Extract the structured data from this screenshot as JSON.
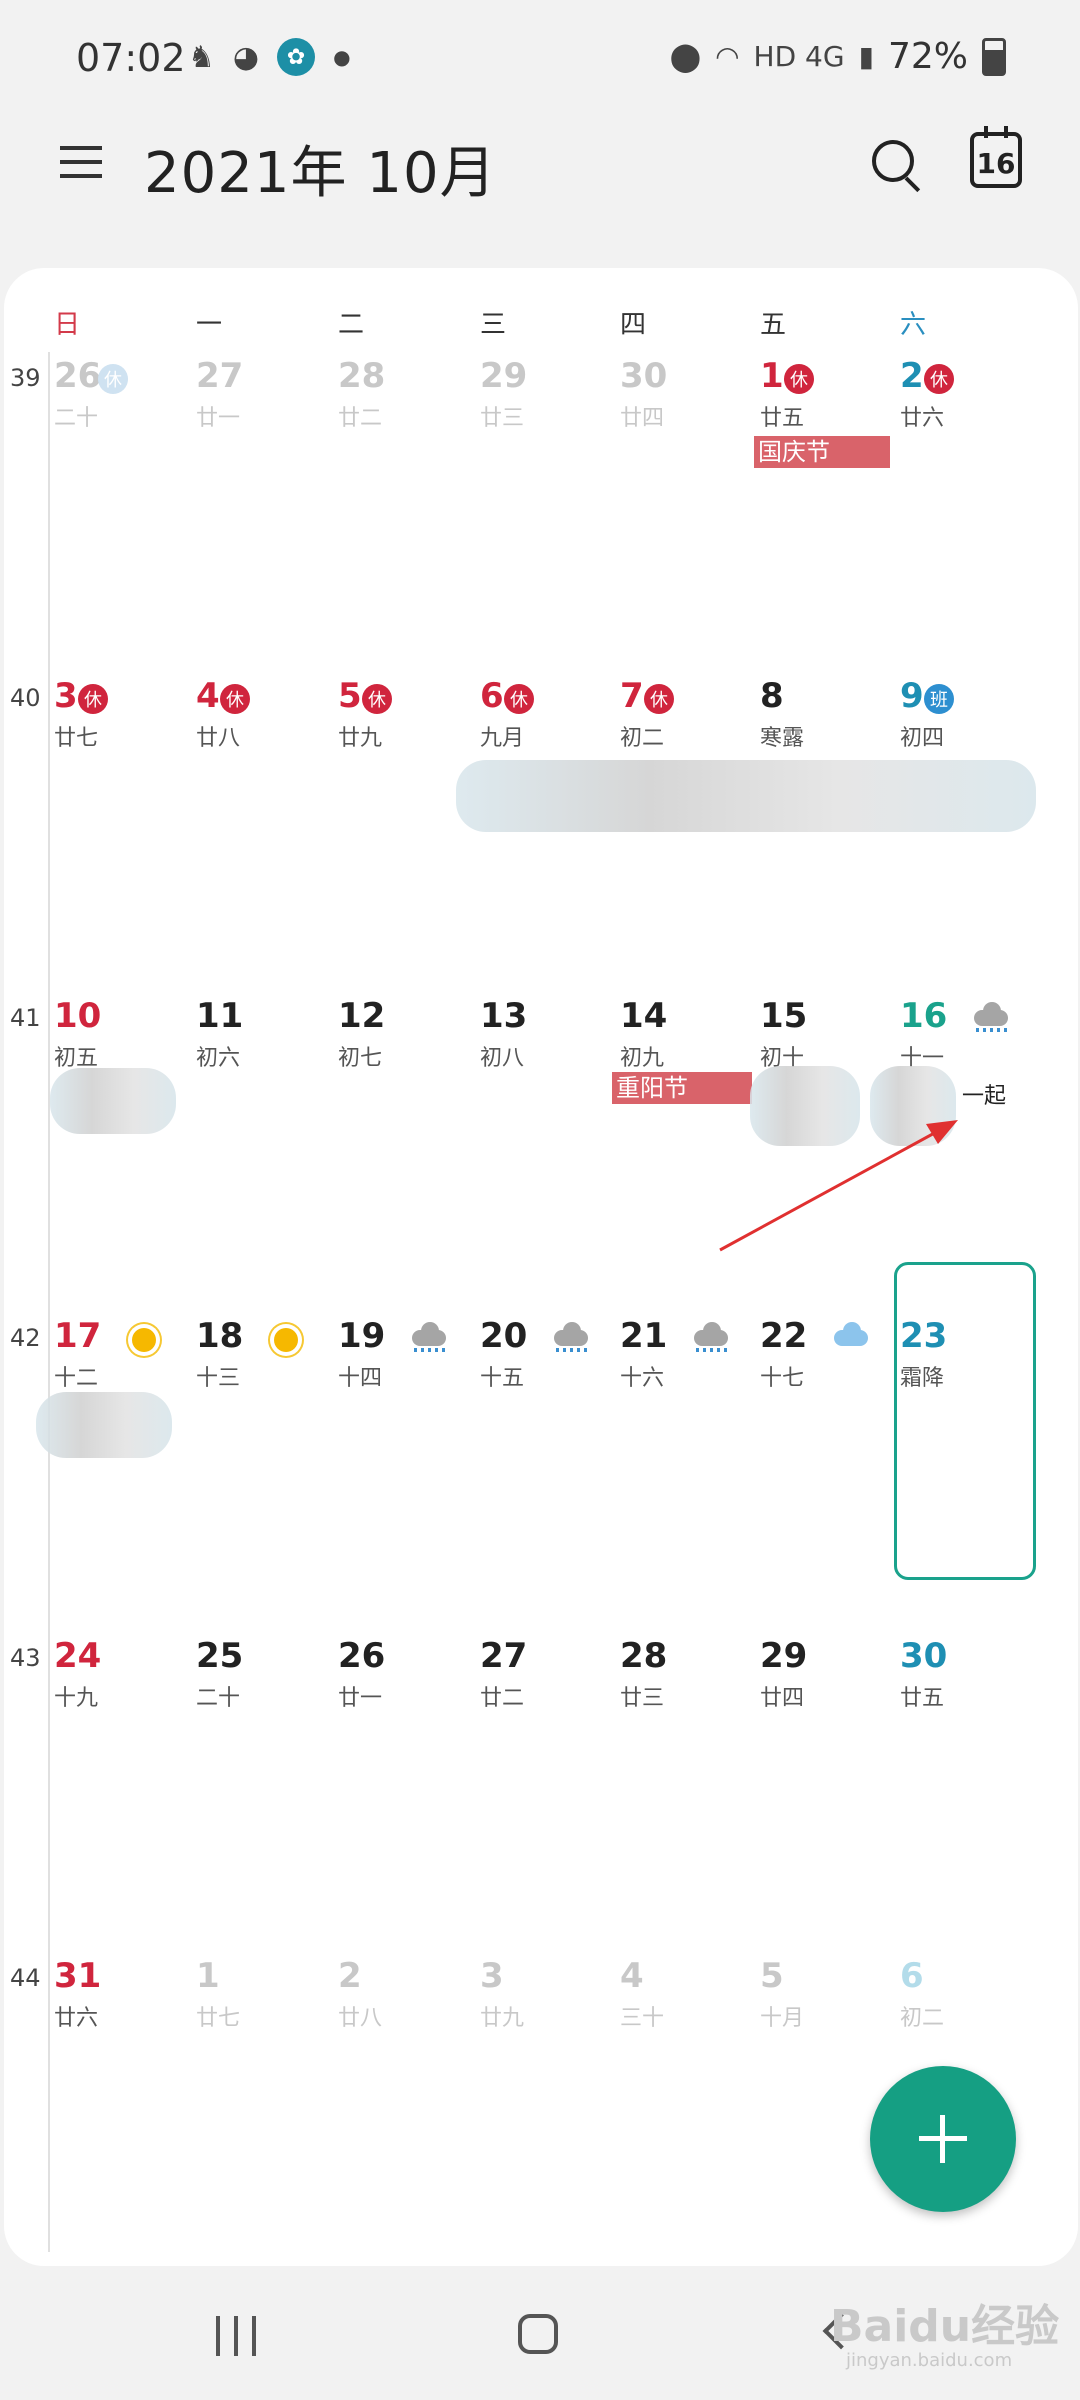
{
  "status_bar": {
    "time": "07:02",
    "network": "HD 4G",
    "battery": "72%"
  },
  "header": {
    "title": "2021年 10月",
    "today_date": "16"
  },
  "weekdays": [
    "日",
    "一",
    "二",
    "三",
    "四",
    "五",
    "六"
  ],
  "weeks": [
    {
      "week_number": "39",
      "days": [
        {
          "day": "26",
          "lunar": "二十",
          "dim": true,
          "badge": "休",
          "badge_type": "faint"
        },
        {
          "day": "27",
          "lunar": "廿一",
          "dim": true
        },
        {
          "day": "28",
          "lunar": "廿二",
          "dim": true
        },
        {
          "day": "29",
          "lunar": "廿三",
          "dim": true
        },
        {
          "day": "30",
          "lunar": "廿四",
          "dim": true
        },
        {
          "day": "1",
          "lunar": "廿五",
          "badge": "休",
          "badge_type": "holiday",
          "holiday_day": true
        },
        {
          "day": "2",
          "lunar": "廿六",
          "badge": "休",
          "badge_type": "holiday",
          "holiday_day": true
        }
      ]
    },
    {
      "week_number": "40",
      "days": [
        {
          "day": "3",
          "lunar": "廿七",
          "badge": "休",
          "badge_type": "holiday"
        },
        {
          "day": "4",
          "lunar": "廿八",
          "badge": "休",
          "badge_type": "holiday",
          "holiday_day": true
        },
        {
          "day": "5",
          "lunar": "廿九",
          "badge": "休",
          "badge_type": "holiday",
          "holiday_day": true
        },
        {
          "day": "6",
          "lunar": "九月",
          "badge": "休",
          "badge_type": "holiday",
          "holiday_day": true
        },
        {
          "day": "7",
          "lunar": "初二",
          "badge": "休",
          "badge_type": "holiday",
          "holiday_day": true
        },
        {
          "day": "8",
          "lunar": "寒露"
        },
        {
          "day": "9",
          "lunar": "初四",
          "badge": "班",
          "badge_type": "work"
        }
      ]
    },
    {
      "week_number": "41",
      "days": [
        {
          "day": "10",
          "lunar": "初五"
        },
        {
          "day": "11",
          "lunar": "初六"
        },
        {
          "day": "12",
          "lunar": "初七"
        },
        {
          "day": "13",
          "lunar": "初八"
        },
        {
          "day": "14",
          "lunar": "初九"
        },
        {
          "day": "15",
          "lunar": "初十"
        },
        {
          "day": "16",
          "lunar": "十一",
          "today": true,
          "weather": "rain"
        }
      ]
    },
    {
      "week_number": "42",
      "days": [
        {
          "day": "17",
          "lunar": "十二",
          "weather": "sun"
        },
        {
          "day": "18",
          "lunar": "十三",
          "weather": "sun"
        },
        {
          "day": "19",
          "lunar": "十四",
          "weather": "rain"
        },
        {
          "day": "20",
          "lunar": "十五",
          "weather": "rain"
        },
        {
          "day": "21",
          "lunar": "十六",
          "weather": "rain"
        },
        {
          "day": "22",
          "lunar": "十七",
          "weather": "cloud"
        },
        {
          "day": "23",
          "lunar": "霜降"
        }
      ]
    },
    {
      "week_number": "43",
      "days": [
        {
          "day": "24",
          "lunar": "十九"
        },
        {
          "day": "25",
          "lunar": "二十"
        },
        {
          "day": "26",
          "lunar": "廿一"
        },
        {
          "day": "27",
          "lunar": "廿二"
        },
        {
          "day": "28",
          "lunar": "廿三"
        },
        {
          "day": "29",
          "lunar": "廿四"
        },
        {
          "day": "30",
          "lunar": "廿五"
        }
      ]
    },
    {
      "week_number": "44",
      "days": [
        {
          "day": "31",
          "lunar": "廿六"
        },
        {
          "day": "1",
          "lunar": "廿七",
          "dim": true
        },
        {
          "day": "2",
          "lunar": "廿八",
          "dim": true
        },
        {
          "day": "3",
          "lunar": "廿九",
          "dim": true
        },
        {
          "day": "4",
          "lunar": "三十",
          "dim": true
        },
        {
          "day": "5",
          "lunar": "十月",
          "dim": true
        },
        {
          "day": "6",
          "lunar": "初二",
          "dim": true
        }
      ]
    }
  ],
  "events": {
    "national_day": "国庆节",
    "chongyang": "重阳节",
    "today_event_fragment": "一起"
  },
  "colors": {
    "accent": "#159f83",
    "sunday": "#d0253d",
    "saturday": "#1e8fb3",
    "event_bar": "#d9636a"
  },
  "icons": {
    "menu": "menu-icon",
    "search": "search-icon",
    "today": "calendar-today-icon",
    "add": "plus-icon"
  },
  "watermark": {
    "brand": "Baidu经验",
    "url": "jingyan.baidu.com"
  }
}
